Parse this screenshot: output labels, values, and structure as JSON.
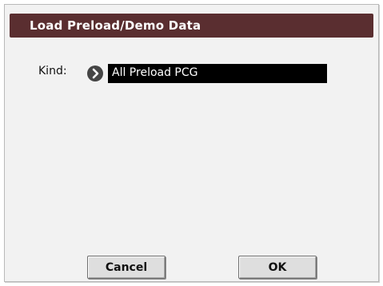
{
  "dialog": {
    "title": "Load Preload/Demo Data",
    "kind": {
      "label": "Kind:",
      "value": "All Preload PCG",
      "arrow_icon": "right-arrow-circle-icon"
    },
    "buttons": {
      "cancel": "Cancel",
      "ok": "OK"
    }
  },
  "colors": {
    "titlebar": "#5a2e30",
    "background": "#f2f2f2",
    "field": "#000000"
  }
}
